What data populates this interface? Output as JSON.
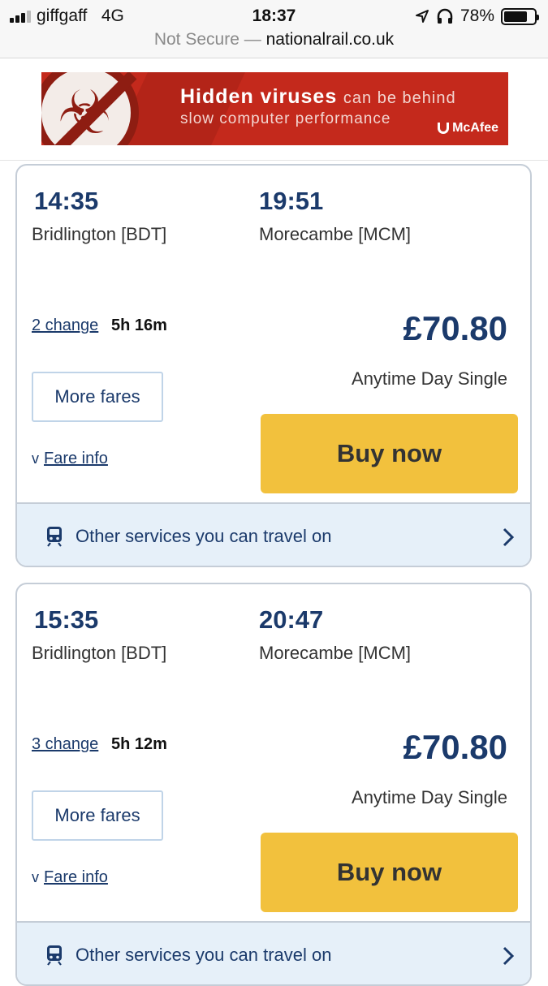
{
  "status_bar": {
    "carrier": "giffgaff",
    "network": "4G",
    "time": "18:37",
    "battery": "78%",
    "battery_level": 0.78
  },
  "browser": {
    "security": "Not Secure",
    "separator": " — ",
    "host": "nationalrail.co.uk"
  },
  "ad": {
    "headline_bold": "Hidden viruses",
    "headline_rest": "can be behind",
    "subline": "slow computer performance",
    "brand": "McAfee",
    "colors": {
      "background": "#c4291c",
      "accent": "#8e1d12"
    }
  },
  "journeys": [
    {
      "departure_time": "14:35",
      "departure_station": "Bridlington [BDT]",
      "arrival_time": "19:51",
      "arrival_station": "Morecambe [MCM]",
      "changes": "2 change",
      "duration": "5h 16m",
      "price": "£70.80",
      "fare_type": "Anytime Day Single",
      "more_fares_label": "More fares",
      "buy_label": "Buy now",
      "fare_info_label": "Fare info",
      "services_label": "Other services you can travel on"
    },
    {
      "departure_time": "15:35",
      "departure_station": "Bridlington [BDT]",
      "arrival_time": "20:47",
      "arrival_station": "Morecambe [MCM]",
      "changes": "3 change",
      "duration": "5h 12m",
      "price": "£70.80",
      "fare_type": "Anytime Day Single",
      "more_fares_label": "More fares",
      "buy_label": "Buy now",
      "fare_info_label": "Fare info",
      "services_label": "Other services you can travel on"
    }
  ],
  "theme": {
    "primary_navy": "#1b3a6b",
    "buy_yellow": "#f2c13d",
    "services_bg": "#e6f0f9"
  }
}
